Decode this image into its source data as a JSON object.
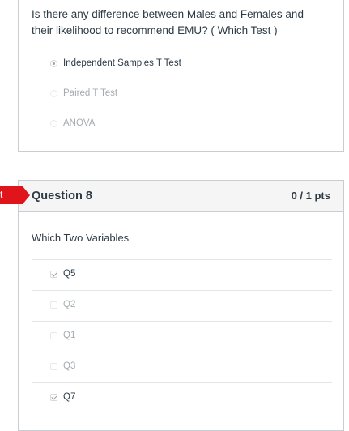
{
  "question7": {
    "text": "Is there any difference between Males and Females and their likelihood to recommend EMU? ( Which Test )",
    "answers": [
      {
        "label": "Independent Samples T Test",
        "selected": true
      },
      {
        "label": "Paired T Test",
        "selected": false
      },
      {
        "label": "ANOVA",
        "selected": false
      }
    ]
  },
  "flag": {
    "label": "t",
    "color": "#e0151b"
  },
  "question8": {
    "title": "Question 8",
    "points": "0 / 1 pts",
    "text": "Which Two Variables",
    "answers": [
      {
        "label": "Q5",
        "checked": true
      },
      {
        "label": "Q2",
        "checked": false
      },
      {
        "label": "Q1",
        "checked": false
      },
      {
        "label": "Q3",
        "checked": false
      },
      {
        "label": "Q7",
        "checked": true
      }
    ]
  }
}
